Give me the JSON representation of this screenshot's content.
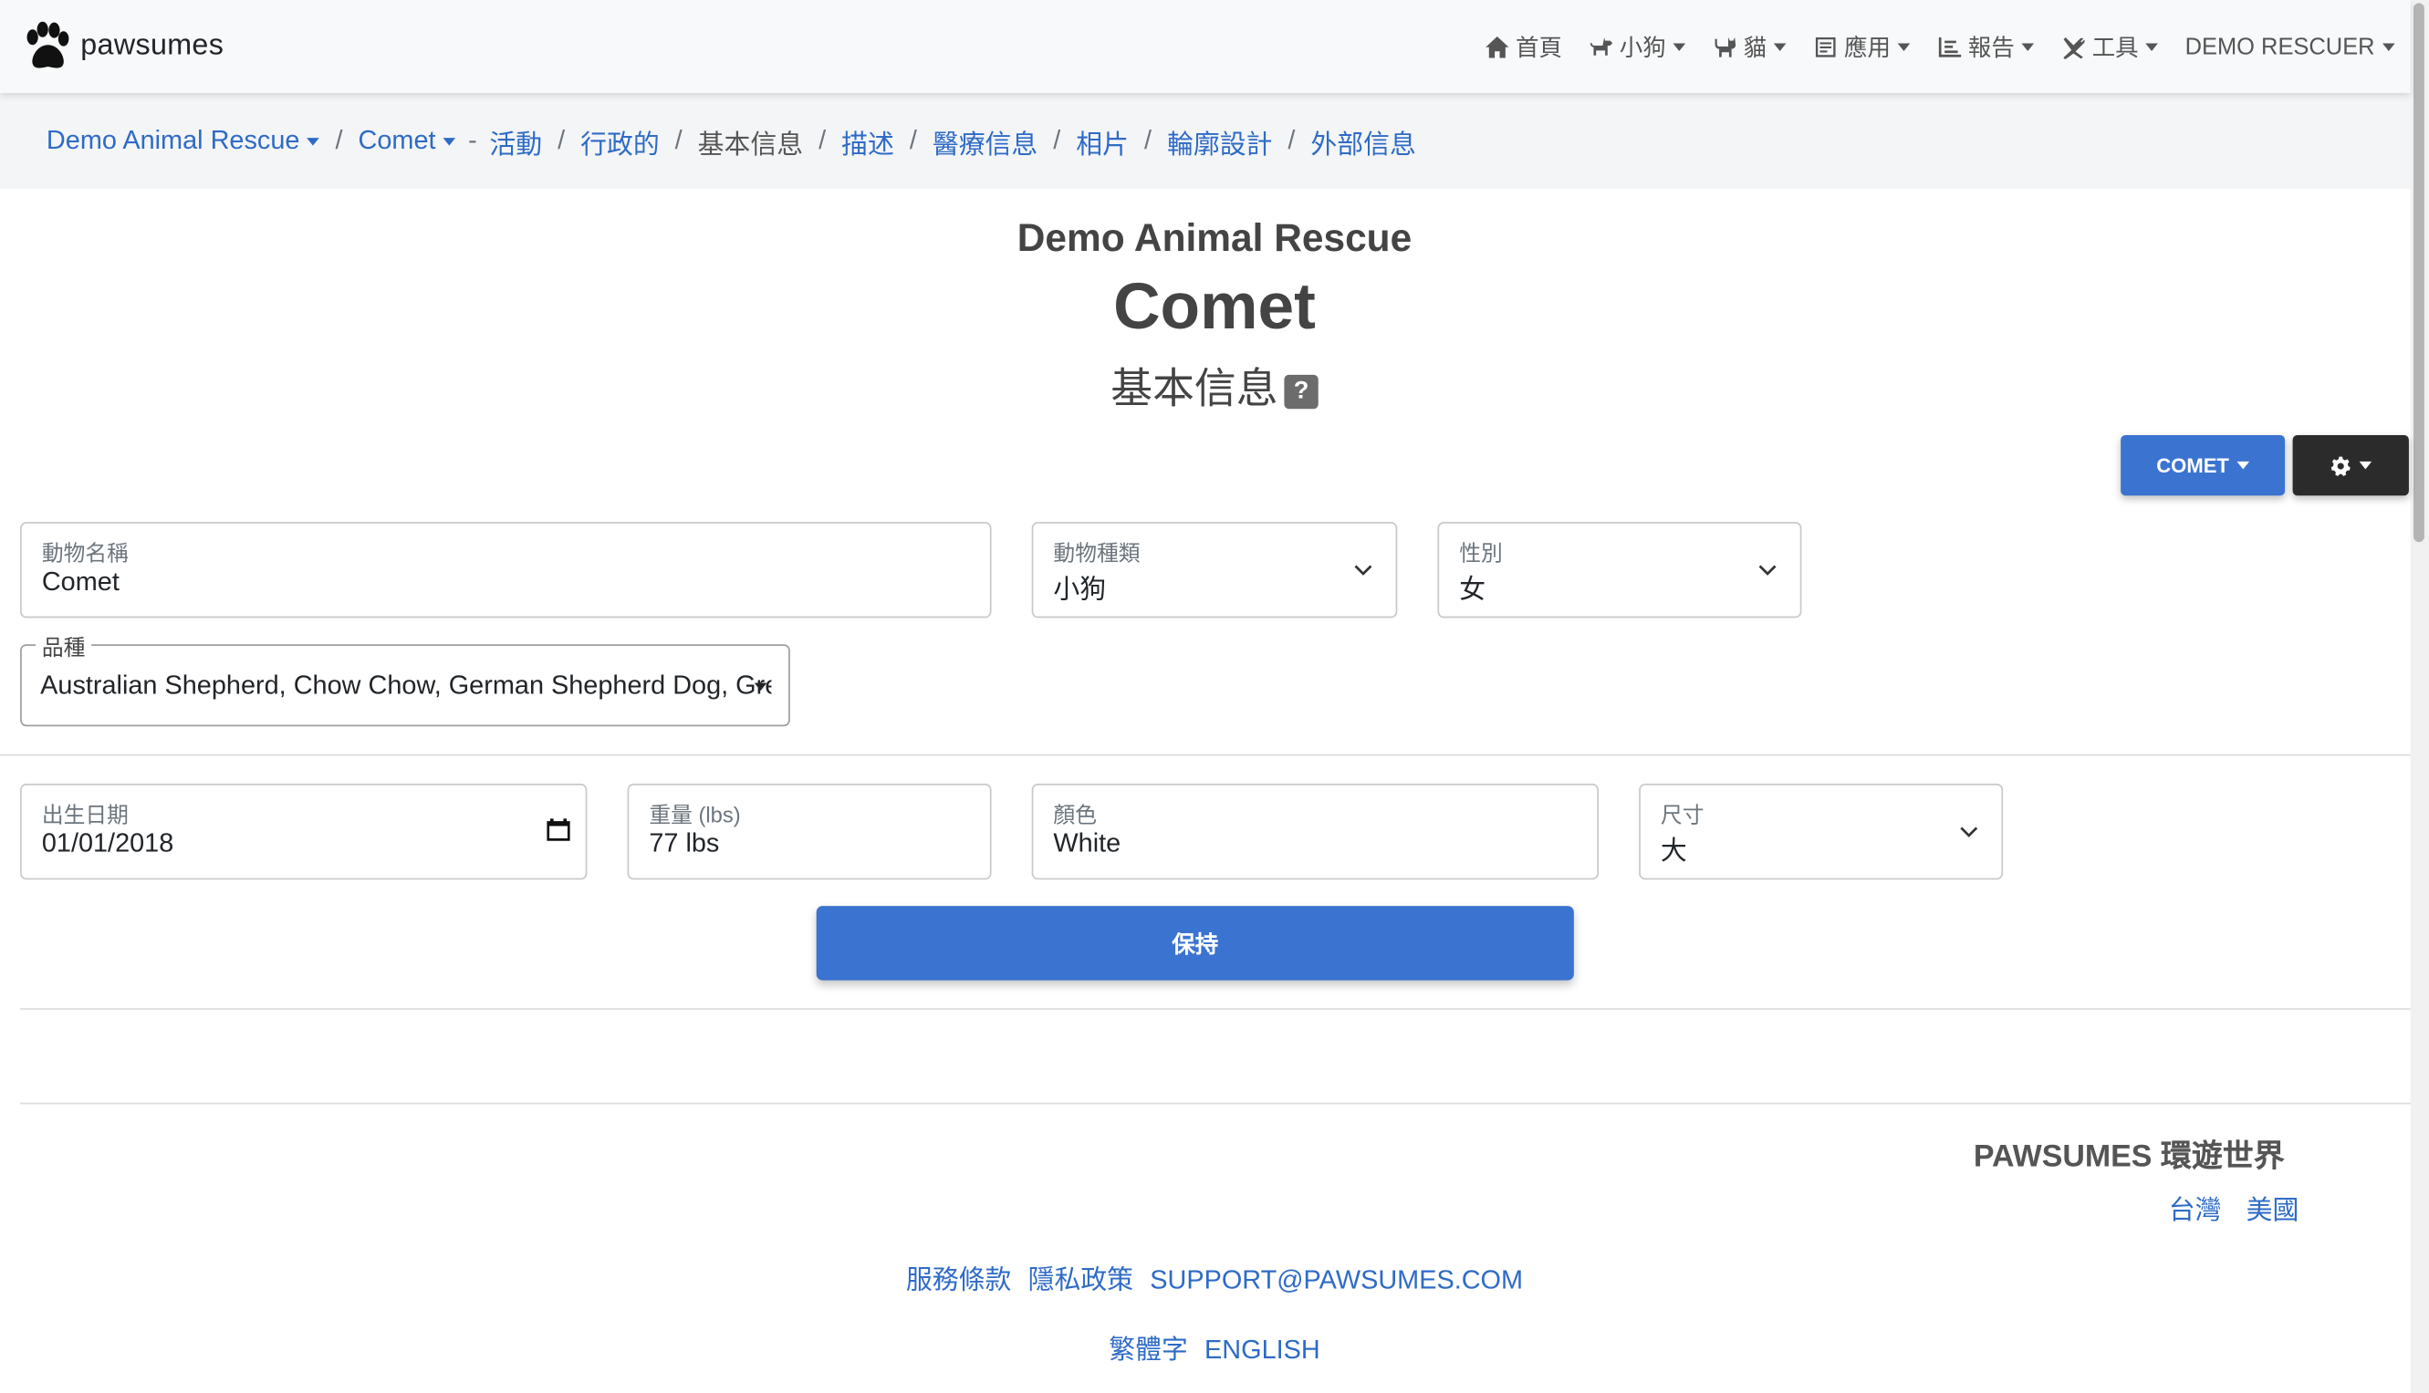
{
  "brand": {
    "name": "pawsumes",
    "logo_icon": "paw-icon"
  },
  "nav": {
    "items": [
      {
        "label": "首頁",
        "icon": "home-icon",
        "dropdown": false
      },
      {
        "label": "小狗",
        "icon": "dog-icon",
        "dropdown": true
      },
      {
        "label": "貓",
        "icon": "cat-icon",
        "dropdown": true
      },
      {
        "label": "應用",
        "icon": "application-icon",
        "dropdown": true
      },
      {
        "label": "報告",
        "icon": "chart-icon",
        "dropdown": true
      },
      {
        "label": "工具",
        "icon": "tools-icon",
        "dropdown": true
      },
      {
        "label": "DEMO RESCUER",
        "icon": "",
        "dropdown": true
      }
    ]
  },
  "breadcrumb": {
    "org": "Demo Animal Rescue",
    "animal": "Comet",
    "dash": "-",
    "items": [
      {
        "label": "活動",
        "active": false
      },
      {
        "label": "行政的",
        "active": false
      },
      {
        "label": "基本信息",
        "active": true
      },
      {
        "label": "描述",
        "active": false
      },
      {
        "label": "醫療信息",
        "active": false
      },
      {
        "label": "相片",
        "active": false
      },
      {
        "label": "輪廓設計",
        "active": false
      },
      {
        "label": "外部信息",
        "active": false
      }
    ],
    "separator": "/"
  },
  "header": {
    "org": "Demo Animal Rescue",
    "animal": "Comet",
    "section": "基本信息",
    "help": "?"
  },
  "actions": {
    "animal_button": "COMET",
    "settings_icon": "gear-icon"
  },
  "form": {
    "name": {
      "label": "動物名稱",
      "value": "Comet"
    },
    "species": {
      "label": "動物種類",
      "value": "小狗"
    },
    "gender": {
      "label": "性別",
      "value": "女"
    },
    "breed": {
      "label": "品種",
      "value": "Australian Shepherd, Chow Chow, German Shepherd Dog, Great Pyrenees"
    },
    "birth_date": {
      "label": "出生日期",
      "value": "01/01/2018"
    },
    "weight": {
      "label": "重量 (lbs)",
      "value": "77 lbs"
    },
    "color": {
      "label": "顏色",
      "value": "White"
    },
    "size": {
      "label": "尺寸",
      "value": "大"
    },
    "save_label": "保持"
  },
  "footer": {
    "brand": "PAWSUMES 環遊世界",
    "countries": [
      "台灣",
      "美國"
    ],
    "links": [
      "服務條款",
      "隱私政策",
      "SUPPORT@PAWSUMES.COM"
    ],
    "languages": [
      "繁體字",
      "ENGLISH"
    ]
  },
  "colors": {
    "primary": "#3b73d0",
    "link": "#2e6bc6",
    "dark_button": "#2b2b2b",
    "navbar": "#f8f9fa"
  }
}
